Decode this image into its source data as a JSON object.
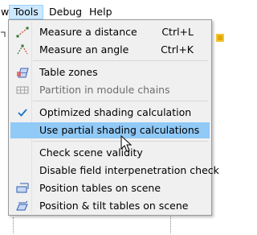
{
  "menubar": {
    "items": [
      {
        "label": "w"
      },
      {
        "label": "Tools"
      },
      {
        "label": "Debug"
      },
      {
        "label": "Help"
      }
    ]
  },
  "menu": {
    "items": [
      {
        "label": "Measure a distance",
        "shortcut": "Ctrl+L",
        "icon": "measure-distance-icon",
        "disabled": false
      },
      {
        "label": "Measure an angle",
        "shortcut": "Ctrl+K",
        "icon": "measure-angle-icon",
        "disabled": false
      },
      {
        "label": "Table zones",
        "shortcut": "",
        "icon": "table-zones-icon",
        "disabled": false
      },
      {
        "label": "Partition in module chains",
        "shortcut": "",
        "icon": "module-chains-icon",
        "disabled": true
      },
      {
        "label": "Optimized shading calculation",
        "shortcut": "",
        "icon": "check-icon",
        "disabled": false,
        "checked": true
      },
      {
        "label": "Use partial shading calculations",
        "shortcut": "",
        "icon": "",
        "disabled": false,
        "highlighted": true
      },
      {
        "label": "Check scene validity",
        "shortcut": "",
        "icon": "",
        "disabled": false
      },
      {
        "label": "Disable field interpenetration check",
        "shortcut": "",
        "icon": "",
        "disabled": false
      },
      {
        "label": "Position tables on scene",
        "shortcut": "",
        "icon": "position-tables-icon",
        "disabled": false
      },
      {
        "label": "Position & tilt tables on scene",
        "shortcut": "",
        "icon": "position-tilt-icon",
        "disabled": false
      }
    ]
  },
  "colors": {
    "highlight": "#91c9f7",
    "active_menubar": "#cce8ff",
    "menu_bg": "#f0f0f0",
    "check": "#1a73c7"
  }
}
